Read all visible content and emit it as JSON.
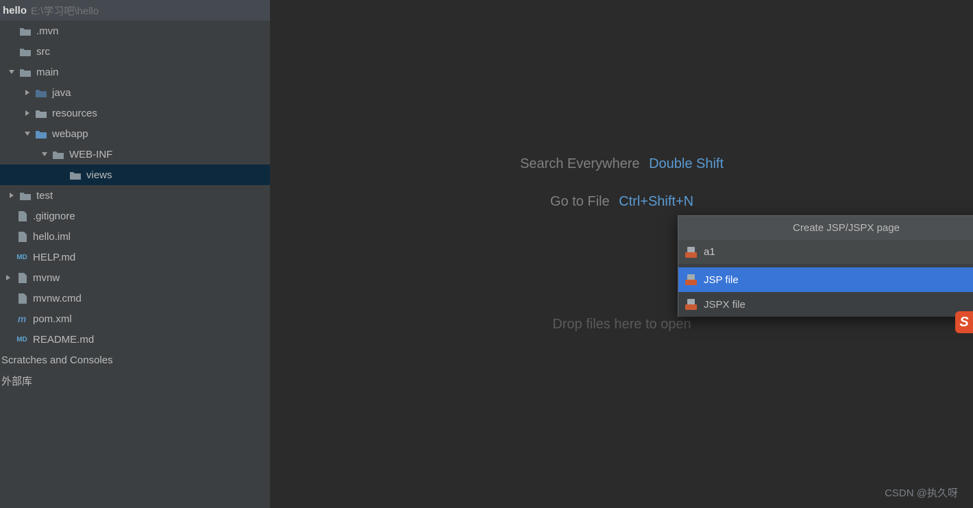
{
  "project": {
    "name": "hello",
    "path": "E:\\学习吧\\hello"
  },
  "tree": {
    "mvn": ".mvn",
    "src": "src",
    "main": "main",
    "java": "java",
    "resources": "resources",
    "webapp": "webapp",
    "webinf": "WEB-INF",
    "views": "views",
    "test": "test",
    "gitignore": ".gitignore",
    "helloiml": "hello.iml",
    "helpmd": "HELP.md",
    "mvnw": "mvnw",
    "mvnwcmd": "mvnw.cmd",
    "pomxml": "pom.xml",
    "readmemd": "README.md",
    "scratches": "Scratches and Consoles",
    "extlib": "外部库"
  },
  "hints": {
    "search_label": "Search Everywhere",
    "search_shortcut": "Double Shift",
    "goto_label": "Go to File",
    "goto_shortcut": "Ctrl+Shift+N",
    "drop_label": "Drop files here to open"
  },
  "popup": {
    "title": "Create JSP/JSPX page",
    "input_value": "a1",
    "items": [
      {
        "label": "JSP file",
        "kind": "jsp",
        "selected": true
      },
      {
        "label": "JSPX file",
        "kind": "jsx",
        "selected": false
      }
    ]
  },
  "watermark": "CSDN @执久呀",
  "side_badge": "S"
}
